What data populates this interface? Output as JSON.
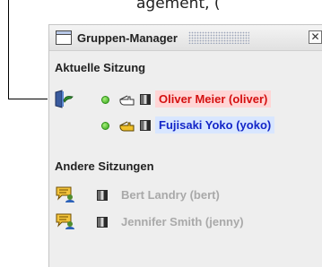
{
  "caption_fragment": "agement, (",
  "window": {
    "title": "Gruppen-Manager",
    "close_glyph": "✕"
  },
  "sections": {
    "current": {
      "heading": "Aktuelle Sitzung",
      "users": [
        {
          "name": "Oliver Meier (oliver)",
          "status": "online",
          "color": "#d41010"
        },
        {
          "name": "Fujisaki Yoko (yoko)",
          "status": "online",
          "color": "#1326c8"
        }
      ]
    },
    "other": {
      "heading": "Andere Sitzungen",
      "users": [
        {
          "name": "Bert Landry (bert)"
        },
        {
          "name": "Jennifer Smith (jenny)"
        }
      ]
    }
  },
  "icons": {
    "leave_session": "door-exit-icon",
    "pointer": "hand-pointer-icon",
    "columns": "column-bar-icon",
    "invite": "invite-chat-icon"
  }
}
